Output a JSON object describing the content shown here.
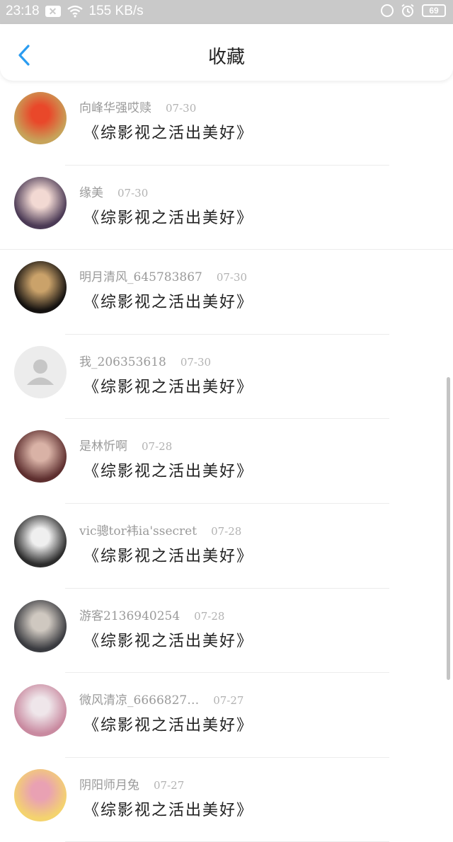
{
  "status_bar": {
    "time": "23:18",
    "network_speed": "155 KB/s",
    "battery": "69"
  },
  "header": {
    "title": "收藏"
  },
  "items": [
    {
      "name": "向峰华强哎赎",
      "date": "07-30",
      "title": "《综影视之活出美好》",
      "avatar_colors": [
        "#c7a35a",
        "#e9482a"
      ]
    },
    {
      "name": "缘美",
      "date": "07-30",
      "title": "《综影视之活出美好》",
      "avatar_colors": [
        "#4b3a55",
        "#f2d9d3"
      ]
    },
    {
      "name": "明月清风_645783867",
      "date": "07-30",
      "title": "《综影视之活出美好》",
      "avatar_colors": [
        "#151210",
        "#caa26a"
      ]
    },
    {
      "name": "我_206353618",
      "date": "07-30",
      "title": "《综影视之活出美好》",
      "avatar_colors": [
        "#ececec",
        "#c6c6c6"
      ]
    },
    {
      "name": "是林忻啊",
      "date": "07-28",
      "title": "《综影视之活出美好》",
      "avatar_colors": [
        "#5e2f2f",
        "#d9b2a6"
      ]
    },
    {
      "name": "vic骢tor袆ia'ssecret",
      "date": "07-28",
      "title": "《综影视之活出美好》",
      "avatar_colors": [
        "#2c2c2c",
        "#efefef"
      ]
    },
    {
      "name": "游客2136940254",
      "date": "07-28",
      "title": "《综影视之活出美好》",
      "avatar_colors": [
        "#3a3b40",
        "#cfc8c0"
      ]
    },
    {
      "name": "微风清凉_6666827…",
      "date": "07-27",
      "title": "《综影视之活出美好》",
      "avatar_colors": [
        "#c98aa0",
        "#efe6ea"
      ]
    },
    {
      "name": "阴阳师月兔",
      "date": "07-27",
      "title": "《综影视之活出美好》",
      "avatar_colors": [
        "#f4d36e",
        "#e9a1b3"
      ]
    }
  ]
}
